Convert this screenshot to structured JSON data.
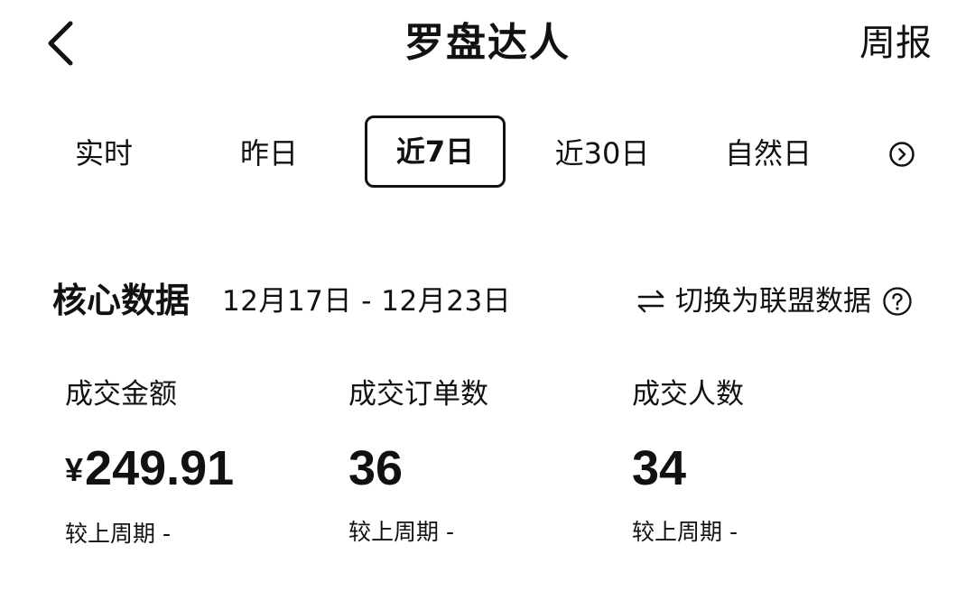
{
  "header": {
    "title": "罗盘达人",
    "right_link": "周报"
  },
  "tabs": [
    {
      "label": "实时"
    },
    {
      "label": "昨日"
    },
    {
      "label": "近7日"
    },
    {
      "label": "近30日"
    },
    {
      "label": "自然日"
    }
  ],
  "active_tab_index": 2,
  "core": {
    "title": "核心数据",
    "date_range": "12月17日 - 12月23日",
    "switch_label": "切换为联盟数据"
  },
  "metrics": [
    {
      "label": "成交金额",
      "currency": "¥",
      "value": "249.91",
      "compare_label": "较上周期",
      "compare_value": "-"
    },
    {
      "label": "成交订单数",
      "value": "36",
      "compare_label": "较上周期",
      "compare_value": "-"
    },
    {
      "label": "成交人数",
      "value": "34",
      "compare_label": "较上周期",
      "compare_value": "-"
    }
  ],
  "icons": {
    "back": "chevron-left-icon",
    "more_tabs": "chevron-right-circle-icon",
    "switch": "swap-arrows-icon",
    "help": "question-circle-icon"
  },
  "colors": {
    "text": "#111111",
    "background": "#ffffff"
  }
}
